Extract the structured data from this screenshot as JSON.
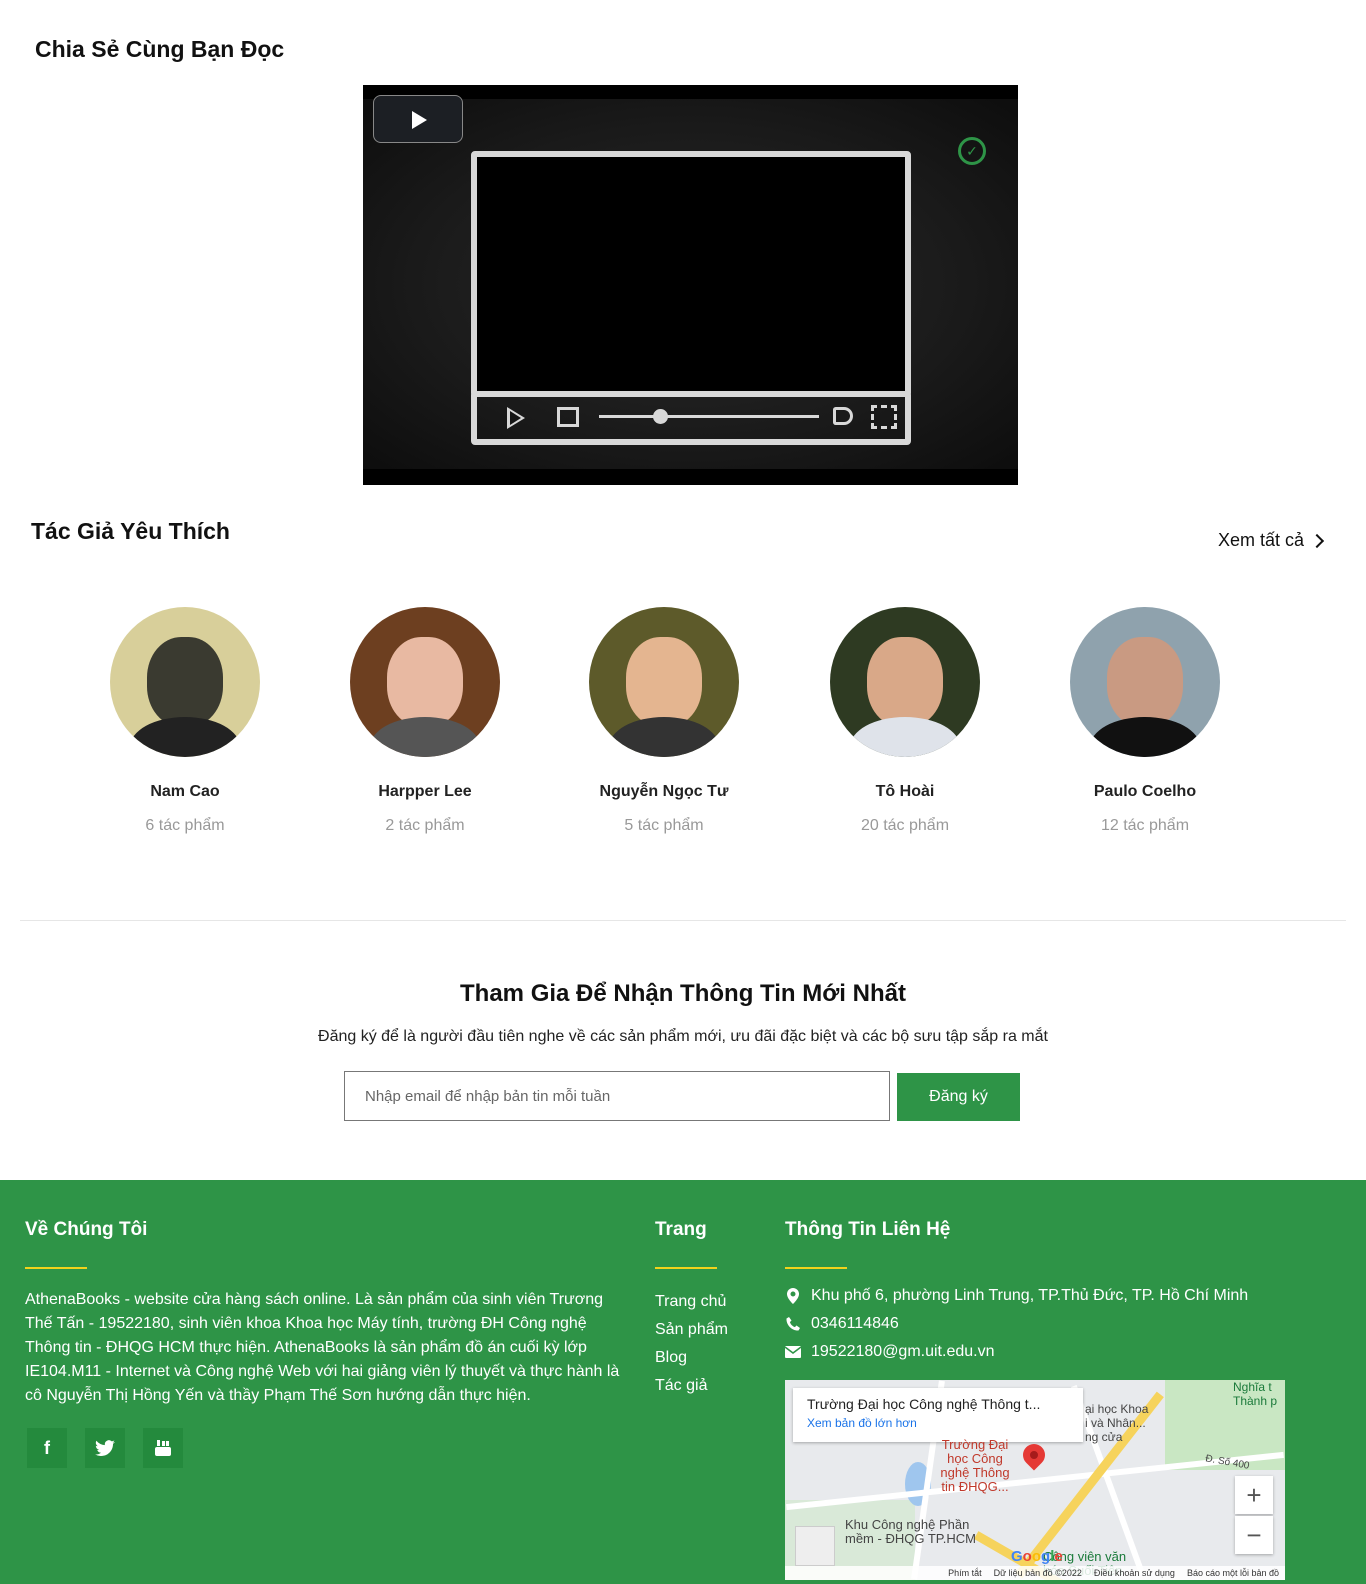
{
  "share": {
    "title": "Chia Sẻ Cùng Bạn Đọc"
  },
  "authors_section": {
    "title": "Tác Giả Yêu Thích",
    "see_all": "Xem tất cả",
    "authors": [
      {
        "name": "Nam Cao",
        "count": "6 tác phẩm"
      },
      {
        "name": "Harpper Lee",
        "count": "2 tác phẩm"
      },
      {
        "name": "Nguyễn Ngọc Tư",
        "count": "5 tác phẩm"
      },
      {
        "name": "Tô Hoài",
        "count": "20 tác phẩm"
      },
      {
        "name": "Paulo Coelho",
        "count": "12 tác phẩm"
      }
    ]
  },
  "newsletter": {
    "title": "Tham Gia Để Nhận Thông Tin Mới Nhất",
    "subtitle": "Đăng ký để là người đầu tiên nghe về các sản phẩm mới, ưu đãi đặc biệt và các bộ sưu tập sắp ra mắt",
    "placeholder": "Nhập email để nhập bản tin mỗi tuần",
    "button": "Đăng ký"
  },
  "footer": {
    "about": {
      "title": "Về Chúng Tôi",
      "text": "AthenaBooks - website cửa hàng sách online. Là sản phẩm của sinh viên Trương Thế Tấn - 19522180, sinh viên khoa Khoa học Máy tính, trường ĐH Công nghệ Thông tin - ĐHQG HCM thực hiện. AthenaBooks là sản phẩm đồ án cuối kỳ lớp IE104.M11 - Internet và Công nghệ Web với hai giảng viên lý thuyết và thực hành là cô Nguyễn Thị Hồng Yến và thầy Phạm Thế Sơn hướng dẫn thực hiện."
    },
    "pages": {
      "title": "Trang",
      "links": [
        "Trang chủ",
        "Sản phẩm",
        "Blog",
        "Tác giả"
      ]
    },
    "contact": {
      "title": "Thông Tin Liên Hệ",
      "address": "Khu phố 6, phường Linh Trung, TP.Thủ Đức, TP. Hồ Chí Minh",
      "phone": "0346114846",
      "email": "19522180@gm.uit.edu.vn"
    },
    "map": {
      "card_title": "Trường Đại học Công nghệ Thông t...",
      "card_link": "Xem bản đồ lớn hơn",
      "place_label": "Trường Đại\nhọc Công\nnghệ Thông\ntin ĐHQG...",
      "label_tech_park": "Khu Công nghệ Phần\nmềm - ĐHQG TP.HCM",
      "label_park": "Công viên văn\nhóa Suối Tiên",
      "label_khoa": "ại học Khoa\ni và Nhân...\nng cửa",
      "label_nghia": "Nghĩa t\nThành p",
      "label_road": "Đ. Số 400",
      "footer_items": [
        "Phím tắt",
        "Dữ liệu bản đồ ©2022",
        "Điều khoản sử dụng",
        "Báo cáo một lỗi bản đồ"
      ],
      "zoom_in": "+",
      "zoom_out": "−"
    }
  },
  "colors": {
    "brand_green": "#2e9447",
    "accent_yellow": "#f2d21c"
  }
}
